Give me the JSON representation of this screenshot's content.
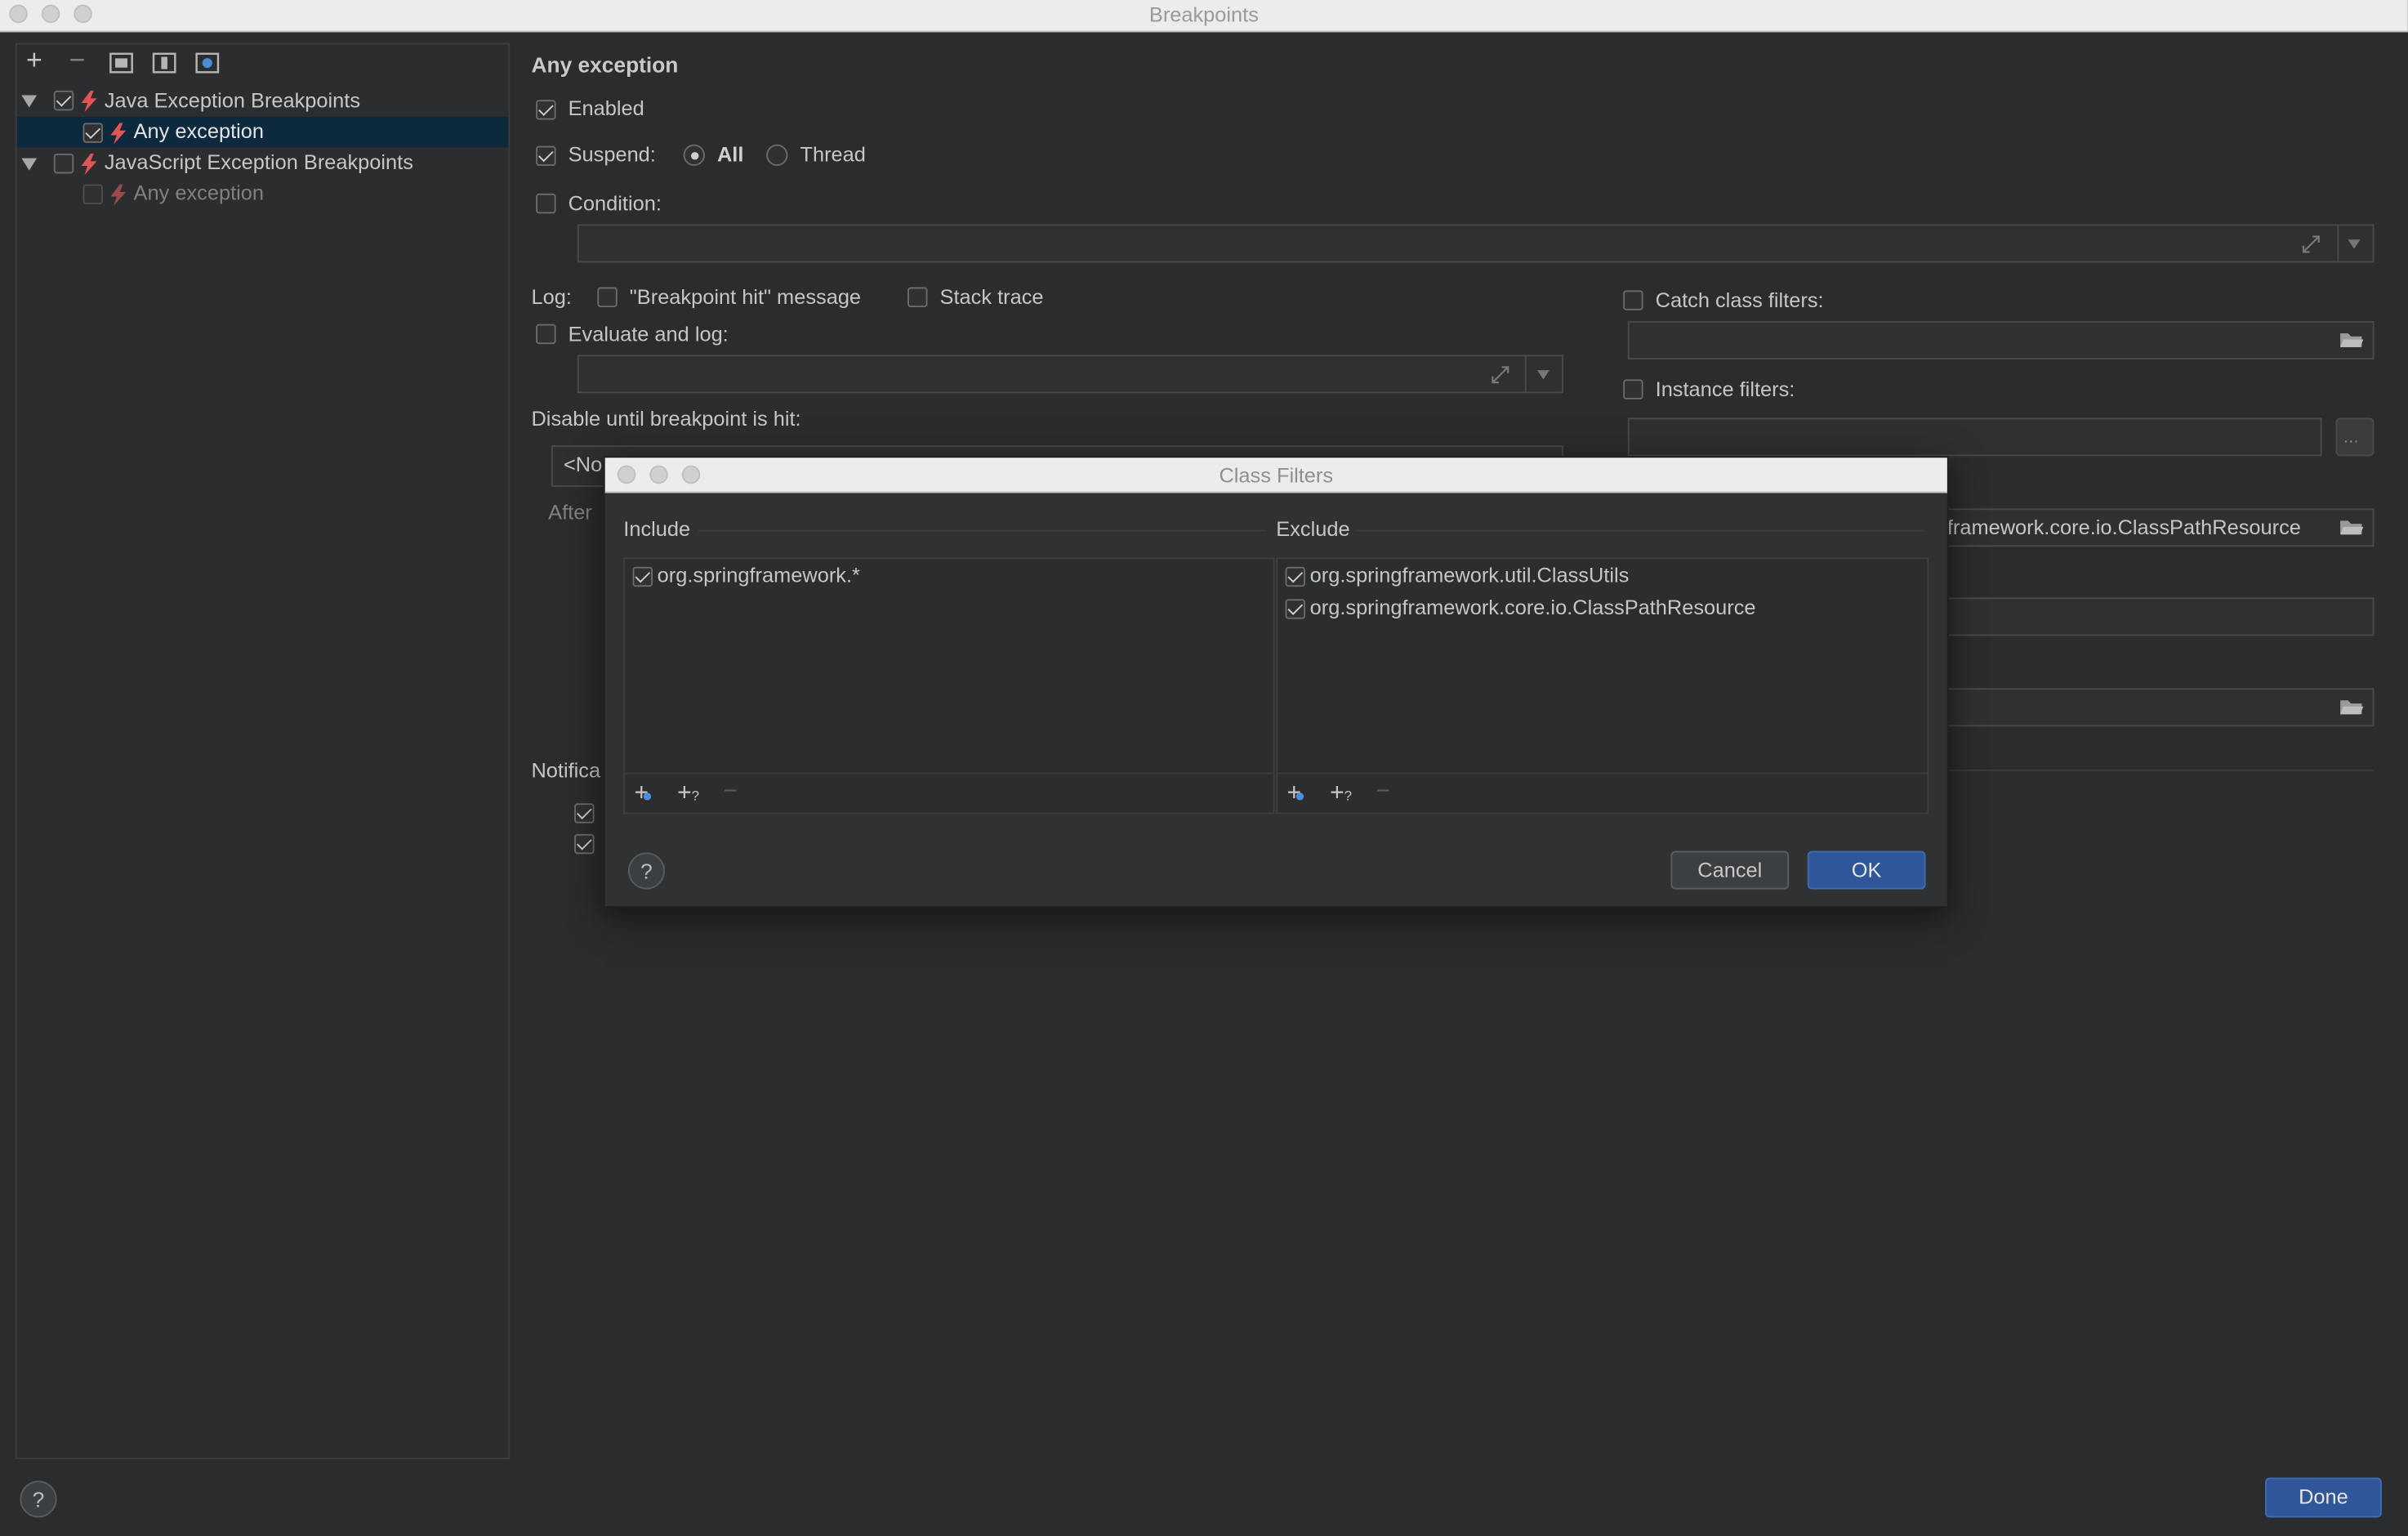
{
  "window": {
    "title": "Breakpoints"
  },
  "toolbar": {
    "add": "+",
    "remove": "−"
  },
  "tree": {
    "java_group": "Java Exception Breakpoints",
    "java_child": "Any exception",
    "js_group": "JavaScript Exception Breakpoints",
    "js_child": "Any exception"
  },
  "details": {
    "title": "Any exception",
    "enabled": "Enabled",
    "suspend": "Suspend:",
    "suspend_all": "All",
    "suspend_thread": "Thread",
    "condition": "Condition:",
    "log": "Log:",
    "log_message": "\"Breakpoint hit\" message",
    "log_stack": "Stack trace",
    "evaluate": "Evaluate and log:",
    "disable_until": "Disable until breakpoint is hit:",
    "disable_value": "<No",
    "after": "After",
    "notifications": "Notifica",
    "catch_filters": "Catch class filters:",
    "instance_filters": "Instance filters:",
    "class_filters_value": "framework.core.io.ClassPathResource",
    "ellipsis": "..."
  },
  "dialog": {
    "title": "Class Filters",
    "include_label": "Include",
    "exclude_label": "Exclude",
    "include_items": [
      "org.springframework.*"
    ],
    "exclude_items": [
      "org.springframework.util.ClassUtils",
      "org.springframework.core.io.ClassPathResource"
    ],
    "add_class": "+",
    "add_pattern": "+",
    "pattern_mark": "?",
    "remove": "−",
    "help": "?",
    "cancel": "Cancel",
    "ok": "OK"
  },
  "footer": {
    "help": "?",
    "done": "Done"
  },
  "colors": {
    "accent": "#2f5698",
    "bolt": "#e05555",
    "selection": "#0d293e"
  }
}
